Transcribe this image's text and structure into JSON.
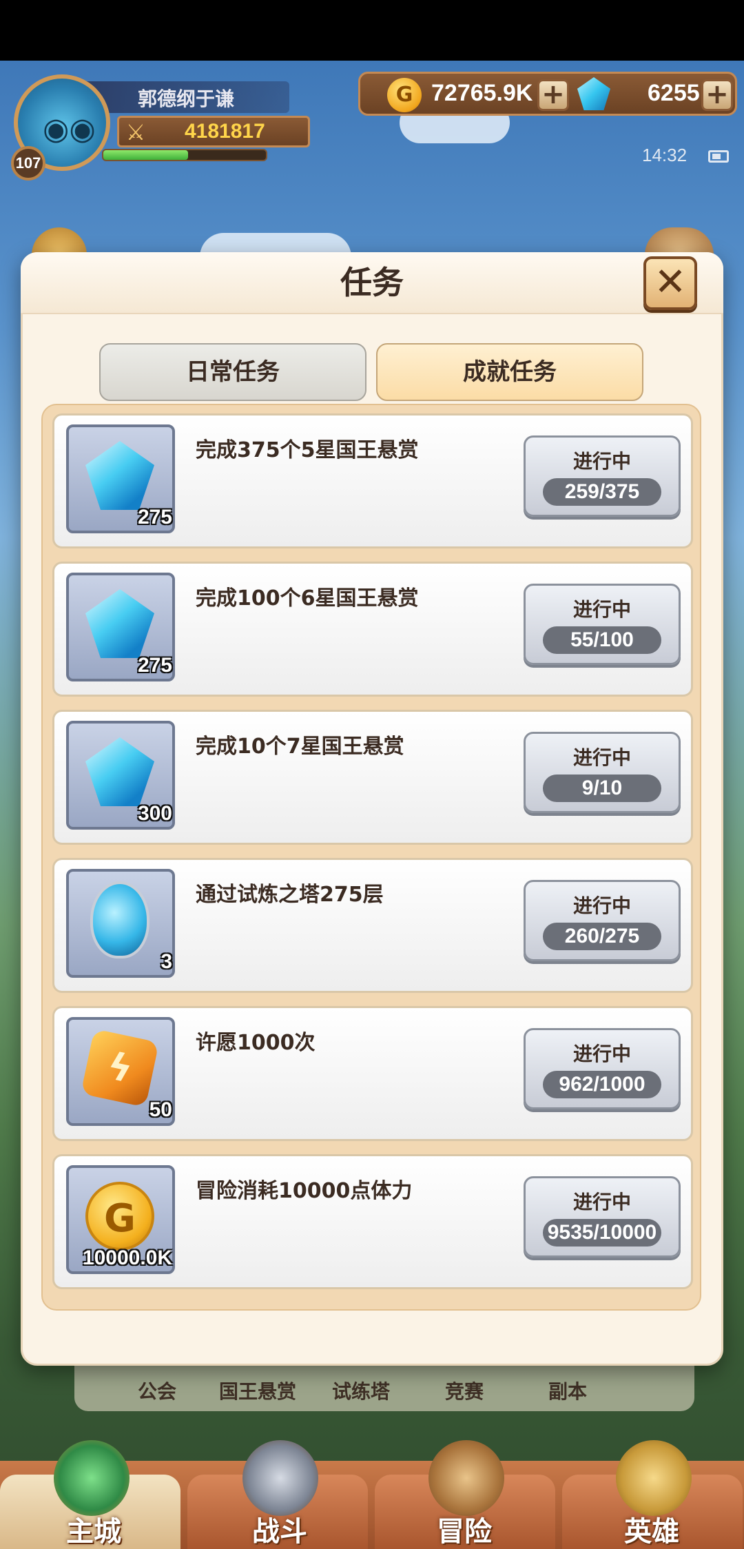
{
  "player": {
    "name": "郭德纲于谦",
    "power": "4181817",
    "level": "107",
    "xp_fraction": 0.52
  },
  "resources": {
    "gold": "72765.9K",
    "gems": "6255"
  },
  "status": {
    "time": "14:32"
  },
  "modal": {
    "title": "任务",
    "close_glyph": "✕",
    "tabs": [
      {
        "label": "日常任务",
        "active": false
      },
      {
        "label": "成就任务",
        "active": true
      }
    ],
    "tasks": [
      {
        "reward_icon": "diamond-icon",
        "reward_count": "275",
        "description": "完成375个5星国王悬赏",
        "status": "进行中",
        "progress": "259/375"
      },
      {
        "reward_icon": "diamond-icon",
        "reward_count": "275",
        "description": "完成100个6星国王悬赏",
        "status": "进行中",
        "progress": "55/100"
      },
      {
        "reward_icon": "diamond-icon",
        "reward_count": "300",
        "description": "完成10个7星国王悬赏",
        "status": "进行中",
        "progress": "9/10"
      },
      {
        "reward_icon": "egg-icon",
        "reward_count": "3",
        "description": "通过试炼之塔275层",
        "status": "进行中",
        "progress": "260/275"
      },
      {
        "reward_icon": "rune-icon",
        "reward_count": "50",
        "description": "许愿1000次",
        "status": "进行中",
        "progress": "962/1000"
      },
      {
        "reward_icon": "gold-coin-icon",
        "reward_count": "10000.0K",
        "description": "冒险消耗10000点体力",
        "status": "进行中",
        "progress": "9535/10000"
      }
    ]
  },
  "subnav": [
    "公会",
    "国王悬赏",
    "试练塔",
    "竞赛",
    "副本"
  ],
  "mainnav": [
    "主城",
    "战斗",
    "冒险",
    "英雄"
  ],
  "colors": {
    "accent_tab": "#fbdca6",
    "modal_bg": "#fbf3e6",
    "frame": "#f2d8b3"
  }
}
